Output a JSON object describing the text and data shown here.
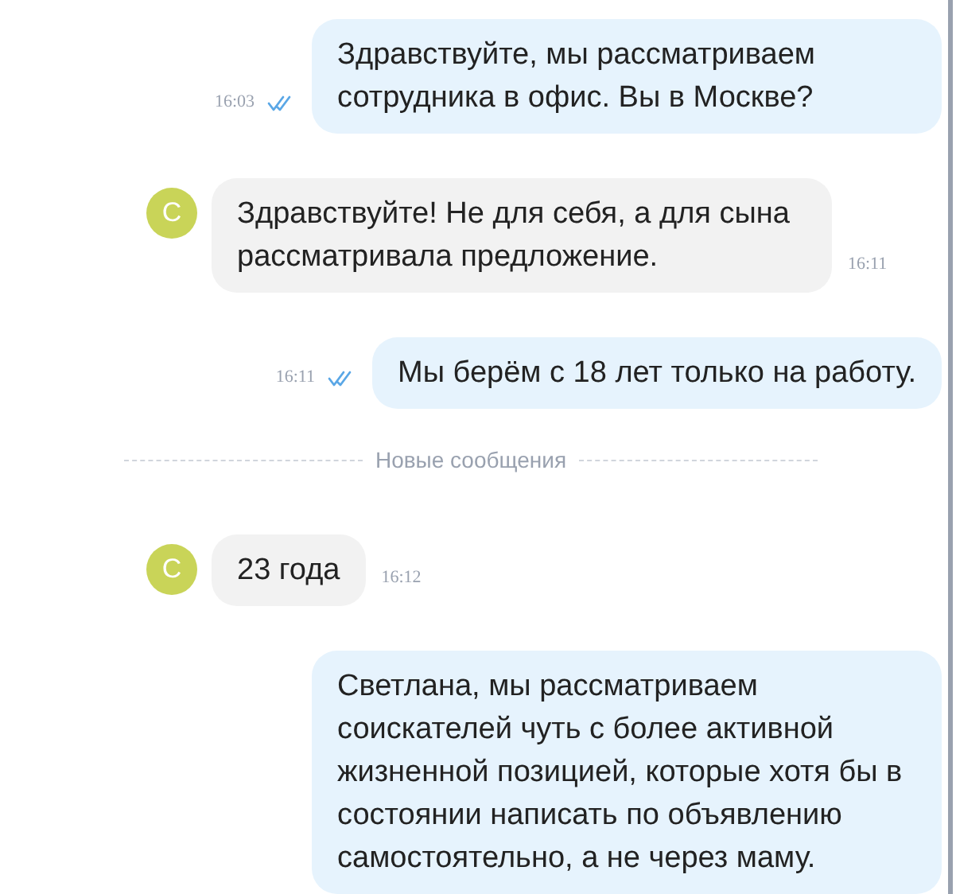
{
  "messages": [
    {
      "kind": "outgoing",
      "text": "Здравствуйте, мы рассматриваем сотрудника в офис. Вы в Москве?",
      "time": "16:03",
      "read": true
    },
    {
      "kind": "incoming",
      "avatar": "С",
      "text": "Здравствуйте! Не для себя, а для сына рассматривала предложение.",
      "time": "16:11"
    },
    {
      "kind": "outgoing",
      "text": "Мы берём с 18 лет только на работу.",
      "time": "16:11",
      "read": true
    },
    {
      "kind": "divider",
      "text": "Новые сообщения"
    },
    {
      "kind": "incoming",
      "avatar": "С",
      "text": "23 года",
      "time": "16:12"
    },
    {
      "kind": "outgoing",
      "text": "Светлана, мы рассматриваем соискателей чуть с более активной жизненной позицией, которые хотя бы в состоянии написать по объявлению самостоятельно, а не через маму."
    }
  ]
}
